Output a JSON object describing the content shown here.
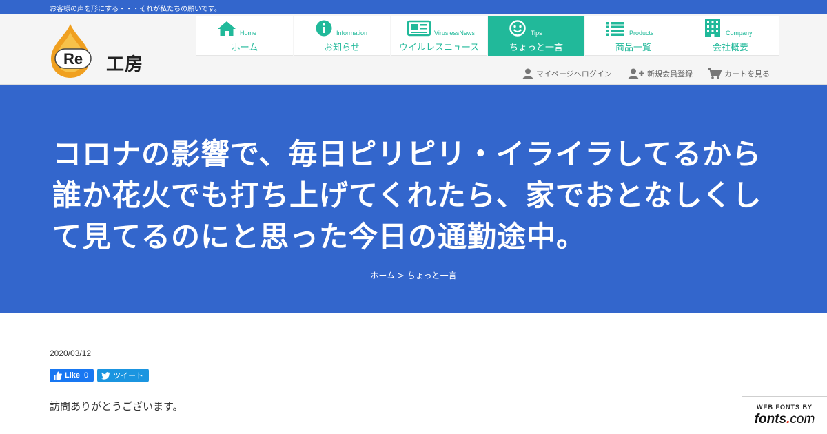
{
  "header": {
    "tagline": "お客様の声を形にする・・・それが私たちの願いです。",
    "logo": {
      "mark": "Re",
      "name": "工房"
    }
  },
  "nav": [
    {
      "en": "Home",
      "jp": "ホーム",
      "icon": "home-icon",
      "active": false
    },
    {
      "en": "Information",
      "jp": "お知らせ",
      "icon": "info-icon",
      "active": false
    },
    {
      "en": "ViruslessNews",
      "jp": "ウイルレスニュース",
      "icon": "newspaper-icon",
      "active": false
    },
    {
      "en": "Tips",
      "jp": "ちょっと一言",
      "icon": "smile-icon",
      "active": true
    },
    {
      "en": "Products",
      "jp": "商品一覧",
      "icon": "list-icon",
      "active": false
    },
    {
      "en": "Company",
      "jp": "会社概要",
      "icon": "building-icon",
      "active": false
    }
  ],
  "account": {
    "login": "マイページへログイン",
    "register": "新規会員登録",
    "cart": "カートを見る"
  },
  "hero": {
    "title": "コロナの影響で、毎日ピリピリ・イライラしてるから誰か花火でも打ち上げてくれたら、家でおとなしくして見てるのにと思った今日の通勤途中。",
    "breadcrumb": {
      "home": "ホーム",
      "separator": ">",
      "current": "ちょっと一言"
    }
  },
  "post": {
    "date": "2020/03/12",
    "like_label": "Like",
    "like_count": "0",
    "tweet_label": "ツイート",
    "body": "訪問ありがとうございます。"
  },
  "badge": {
    "top": "WEB FONTS BY",
    "brand_main": "fonts",
    "brand_dot": ".",
    "brand_tld": "com"
  },
  "colors": {
    "brand_blue": "#3366cc",
    "accent_green": "#21b99a",
    "logo_orange": "#f0a020"
  }
}
